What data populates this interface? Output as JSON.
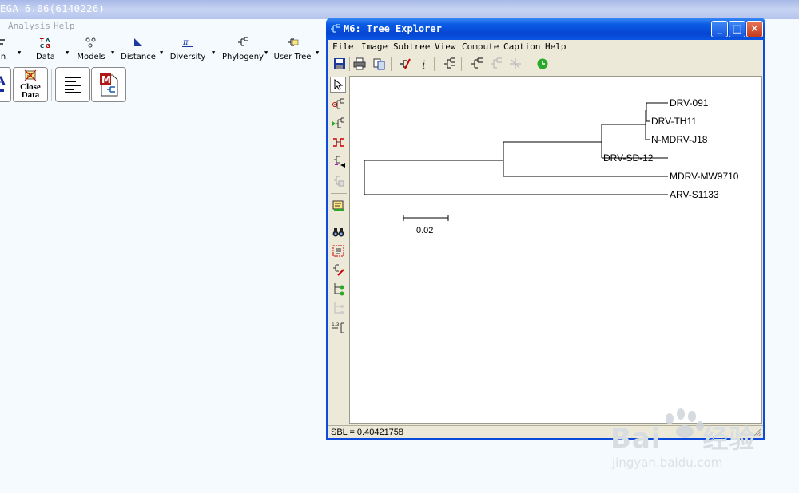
{
  "main_window": {
    "title": "EGA 6.06(6140226)",
    "menu": [
      "Analysis",
      "Help"
    ],
    "toolbar": [
      {
        "label": "n",
        "icon": "align-icon"
      },
      {
        "label": "Data",
        "icon": "data-icon"
      },
      {
        "label": "Models",
        "icon": "models-icon"
      },
      {
        "label": "Distance",
        "icon": "distance-icon"
      },
      {
        "label": "Diversity",
        "icon": "diversity-icon"
      },
      {
        "label": "Phylogeny",
        "icon": "phylogeny-icon"
      },
      {
        "label": "User Tree",
        "icon": "user-tree-icon"
      }
    ],
    "quick_buttons": [
      {
        "label": "",
        "icon": "open-a-icon"
      },
      {
        "label_line1": "Close",
        "label_line2": "Data",
        "icon": "close-data-icon"
      },
      {
        "label": "",
        "icon": "text-editor-icon"
      },
      {
        "label": "",
        "icon": "mega-tree-icon"
      }
    ]
  },
  "tree_explorer": {
    "title": "M6: Tree Explorer",
    "menu": [
      "File",
      "Image",
      "Subtree",
      "View",
      "Compute",
      "Caption",
      "Help"
    ],
    "status": "SBL = 0.40421758",
    "scale_label": "0.02",
    "leaves": [
      "DRV-091",
      "DRV-TH11",
      "N-MDRV-J18",
      "DRV-SD-12",
      "MDRV-MW9710",
      "ARV-S1133"
    ]
  },
  "watermark": {
    "brand": "Bai",
    "brand2": "经验",
    "url": "jingyan.baidu.com"
  }
}
